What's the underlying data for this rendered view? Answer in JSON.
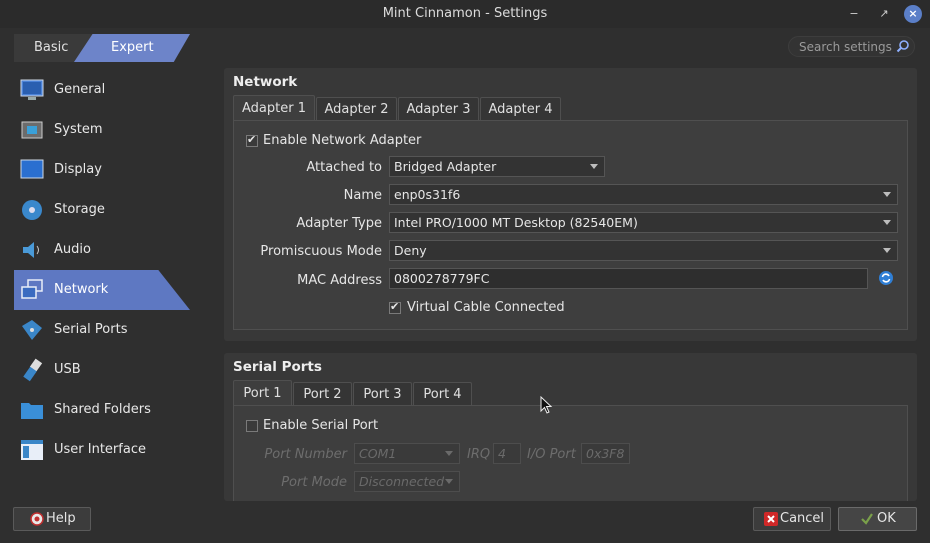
{
  "window": {
    "title": "Mint Cinnamon - Settings"
  },
  "mode": {
    "basic": "Basic",
    "expert": "Expert"
  },
  "search": {
    "placeholder": "Search settings"
  },
  "sidebar": {
    "items": [
      {
        "label": "General",
        "icon": "monitor-icon"
      },
      {
        "label": "System",
        "icon": "chip-icon"
      },
      {
        "label": "Display",
        "icon": "display-icon"
      },
      {
        "label": "Storage",
        "icon": "disk-icon"
      },
      {
        "label": "Audio",
        "icon": "speaker-icon"
      },
      {
        "label": "Network",
        "icon": "network-icon",
        "active": true
      },
      {
        "label": "Serial Ports",
        "icon": "serial-port-icon"
      },
      {
        "label": "USB",
        "icon": "usb-icon"
      },
      {
        "label": "Shared Folders",
        "icon": "folder-icon"
      },
      {
        "label": "User Interface",
        "icon": "window-icon"
      }
    ]
  },
  "network": {
    "title": "Network",
    "tabs": [
      "Adapter 1",
      "Adapter 2",
      "Adapter 3",
      "Adapter 4"
    ],
    "enable_label": "Enable Network Adapter",
    "attached_label": "Attached to",
    "attached_value": "Bridged Adapter",
    "name_label": "Name",
    "name_value": "enp0s31f6",
    "adapter_type_label": "Adapter Type",
    "adapter_type_value": "Intel PRO/1000 MT Desktop (82540EM)",
    "promiscuous_label": "Promiscuous Mode",
    "promiscuous_value": "Deny",
    "mac_label": "MAC Address",
    "mac_value": "0800278779FC",
    "cable_label": "Virtual Cable Connected"
  },
  "serial": {
    "title": "Serial Ports",
    "tabs": [
      "Port 1",
      "Port 2",
      "Port 3",
      "Port 4"
    ],
    "enable_label": "Enable Serial Port",
    "port_number_label": "Port Number",
    "port_number_value": "COM1",
    "irq_label": "IRQ",
    "irq_value": "4",
    "io_port_label": "I/O Port",
    "io_port_value": "0x3F8",
    "port_mode_label": "Port Mode",
    "port_mode_value": "Disconnected"
  },
  "buttons": {
    "help": "Help",
    "cancel": "Cancel",
    "ok": "OK"
  },
  "colors": {
    "accent": "#5e78c2",
    "background": "#2f2f2f",
    "panel": "#383838"
  }
}
